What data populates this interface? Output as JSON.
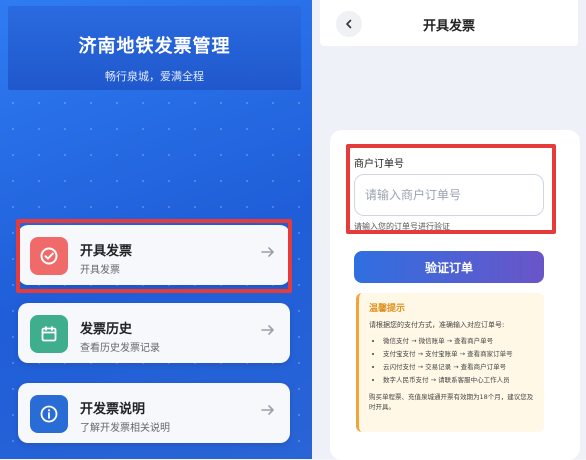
{
  "left": {
    "app_title": "济南地铁发票管理",
    "app_subtitle": "畅行泉城，爱满全程",
    "menu": [
      {
        "title": "开具发票",
        "subtitle": "开具发票",
        "icon": "check-circle-icon",
        "color": "#f06a6a"
      },
      {
        "title": "发票历史",
        "subtitle": "查看历史发票记录",
        "icon": "calendar-icon",
        "color": "#3fae8c"
      },
      {
        "title": "开发票说明",
        "subtitle": "了解开发票相关说明",
        "icon": "info-icon",
        "color": "#2a6cd6"
      }
    ]
  },
  "right": {
    "page_title": "开具发票",
    "field_label": "商户订单号",
    "input_placeholder": "请输入商户订单号",
    "input_value": "",
    "field_hint": "请输入您的订单号进行验证",
    "verify_button": "验证订单",
    "tips": {
      "title": "温馨提示",
      "intro": "请根据您的支付方式，准确输入对应订单号:",
      "items": [
        "微信支付 → 微信账单 → 查看商户单号",
        "支付宝支付 → 支付宝账单 → 查看商家订单号",
        "云闪付支付 → 交易记录 → 查看商户订单号",
        "数字人民币支付 → 请联系客服中心工作人员"
      ],
      "note": "购买单程票、充值泉城通开票有效期为18个月，建议您及时开具。"
    }
  },
  "colors": {
    "highlight": "#e53b3b",
    "brand_blue": "#2058cc"
  }
}
